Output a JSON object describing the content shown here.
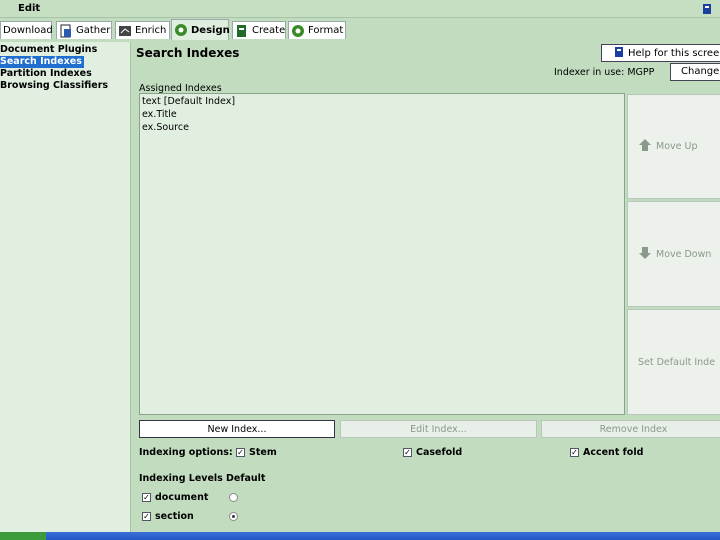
{
  "menubar": {
    "edit_label": "Edit"
  },
  "tabs": [
    {
      "label": "Download",
      "icon": "download-icon"
    },
    {
      "label": "Gather",
      "icon": "gather-icon"
    },
    {
      "label": "Enrich",
      "icon": "enrich-icon"
    },
    {
      "label": "Design",
      "icon": "design-gear-icon",
      "active": true
    },
    {
      "label": "Create",
      "icon": "create-icon"
    },
    {
      "label": "Format",
      "icon": "format-gear-icon"
    }
  ],
  "sidebar": {
    "items": [
      {
        "label": "Document Plugins"
      },
      {
        "label": "Search Indexes",
        "selected": true
      },
      {
        "label": "Partition Indexes"
      },
      {
        "label": "Browsing Classifiers"
      }
    ]
  },
  "main": {
    "title": "Search Indexes",
    "help_button": "Help for this scree",
    "indexer_label": "Indexer in use: MGPP",
    "change_button": "Change.",
    "assigned_label": "Assigned Indexes",
    "indexes": [
      "text [Default Index]",
      "ex.Title",
      "ex.Source"
    ],
    "move_up": "Move Up",
    "move_down": "Move Down",
    "set_default": "Set Default Inde",
    "new_index": "New Index...",
    "edit_index": "Edit Index...",
    "remove_index": "Remove Index",
    "indexing_options_label": "Indexing options:",
    "options": [
      {
        "label": "Stem",
        "checked": true
      },
      {
        "label": "Casefold",
        "checked": true
      },
      {
        "label": "Accent fold",
        "checked": true
      }
    ],
    "levels_label": "Indexing Levels",
    "default_label": "Default",
    "levels": [
      {
        "label": "document",
        "checked": true,
        "default": false
      },
      {
        "label": "section",
        "checked": true,
        "default": true
      }
    ]
  },
  "colors": {
    "background": "#c2dcbf",
    "panel": "#e0efe0",
    "selection": "#1f6ed0",
    "disabled_text": "#8a9a8a"
  }
}
